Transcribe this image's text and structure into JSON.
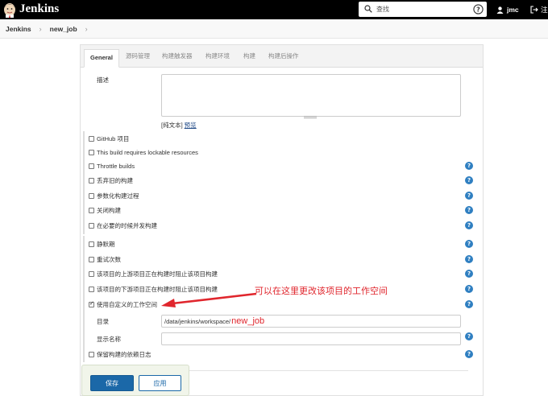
{
  "header": {
    "brand": "Jenkins",
    "search_placeholder": "查找",
    "user": "jmc",
    "logout_label": "注"
  },
  "breadcrumb": [
    "Jenkins",
    "new_job"
  ],
  "tabs": [
    "General",
    "源码管理",
    "构建触发器",
    "构建环境",
    "构建",
    "构建后操作"
  ],
  "description": {
    "label": "描述",
    "value": "",
    "hint_plain": "[纯文本]",
    "hint_preview": "预览"
  },
  "options_group1": [
    {
      "label": "GitHub 项目",
      "checked": false,
      "help": false
    },
    {
      "label": "This build requires lockable resources",
      "checked": false,
      "help": false
    },
    {
      "label": "Throttle builds",
      "checked": false,
      "help": true
    },
    {
      "label": "丢弃旧的构建",
      "checked": false,
      "help": true
    },
    {
      "label": "参数化构建过程",
      "checked": false,
      "help": true
    },
    {
      "label": "关闭构建",
      "checked": false,
      "help": true
    },
    {
      "label": "在必要的时候并发构建",
      "checked": false,
      "help": true
    }
  ],
  "options_group2": [
    {
      "label": "静默期",
      "checked": false,
      "help": true
    },
    {
      "label": "重试次数",
      "checked": false,
      "help": true
    },
    {
      "label": "该项目的上游项目正在构建时阻止该项目构建",
      "checked": false,
      "help": true
    },
    {
      "label": "该项目的下游项目正在构建时阻止该项目构建",
      "checked": false,
      "help": true
    },
    {
      "label": "使用自定义的工作空间",
      "checked": true,
      "help": true
    }
  ],
  "workspace": {
    "dir_label": "目录",
    "dir_value_prefix": "/data/jenkins/workspace/",
    "dir_value_suffix": "new_job",
    "display_name_label": "显示名称",
    "display_name_value": ""
  },
  "keep_deps": {
    "label": "保留构建的依赖日志",
    "checked": false
  },
  "annotation": "可以在这里更改该项目的工作空间",
  "buttons": {
    "save": "保存",
    "apply": "应用"
  },
  "colors": {
    "header": "#000000",
    "primary": "#1b68a8",
    "help": "#2f7fc1",
    "annotation": "#e0262d"
  }
}
